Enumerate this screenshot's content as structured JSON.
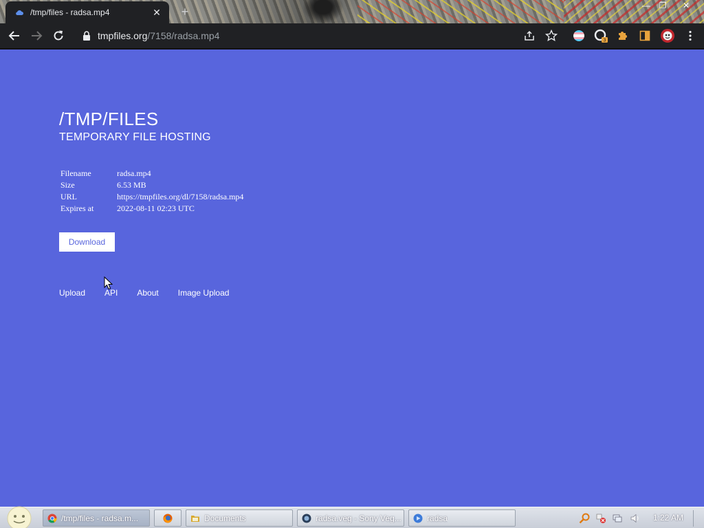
{
  "browser": {
    "tab_title": "/tmp/files - radsa.mp4",
    "tab_close": "✕",
    "new_tab": "+",
    "url_host": "tmpfiles.org",
    "url_path": "/7158/radsa.mp4",
    "window_controls": {
      "minimize": "—",
      "maximize": "❐",
      "close": "✕"
    }
  },
  "page": {
    "title": "/TMP/FILES",
    "subtitle": "TEMPORARY FILE HOSTING",
    "file_info": [
      {
        "label": "Filename",
        "value": "radsa.mp4"
      },
      {
        "label": "Size",
        "value": "6.53 MB"
      },
      {
        "label": "URL",
        "value": "https://tmpfiles.org/dl/7158/radsa.mp4"
      },
      {
        "label": "Expires at",
        "value": "2022-08-11 02:23 UTC"
      }
    ],
    "download_label": "Download",
    "footer_links": [
      "Upload",
      "API",
      "About",
      "Image Upload"
    ]
  },
  "taskbar": {
    "tasks": [
      {
        "label": "/tmp/files - radsa.m...",
        "icon": "chrome-icon"
      },
      {
        "label": "",
        "icon": "firefox-icon"
      },
      {
        "label": "Documents",
        "icon": "folder-icon"
      },
      {
        "label": "radsa.veg - Sony Veg...",
        "icon": "vegas-icon"
      },
      {
        "label": "radsa",
        "icon": "media-icon"
      }
    ],
    "clock": "1:22 AM"
  },
  "extensions": {
    "badge_count": "3"
  },
  "colors": {
    "page_bg": "#5865dd",
    "chrome_bg": "#202124",
    "text": "#ffffff"
  }
}
